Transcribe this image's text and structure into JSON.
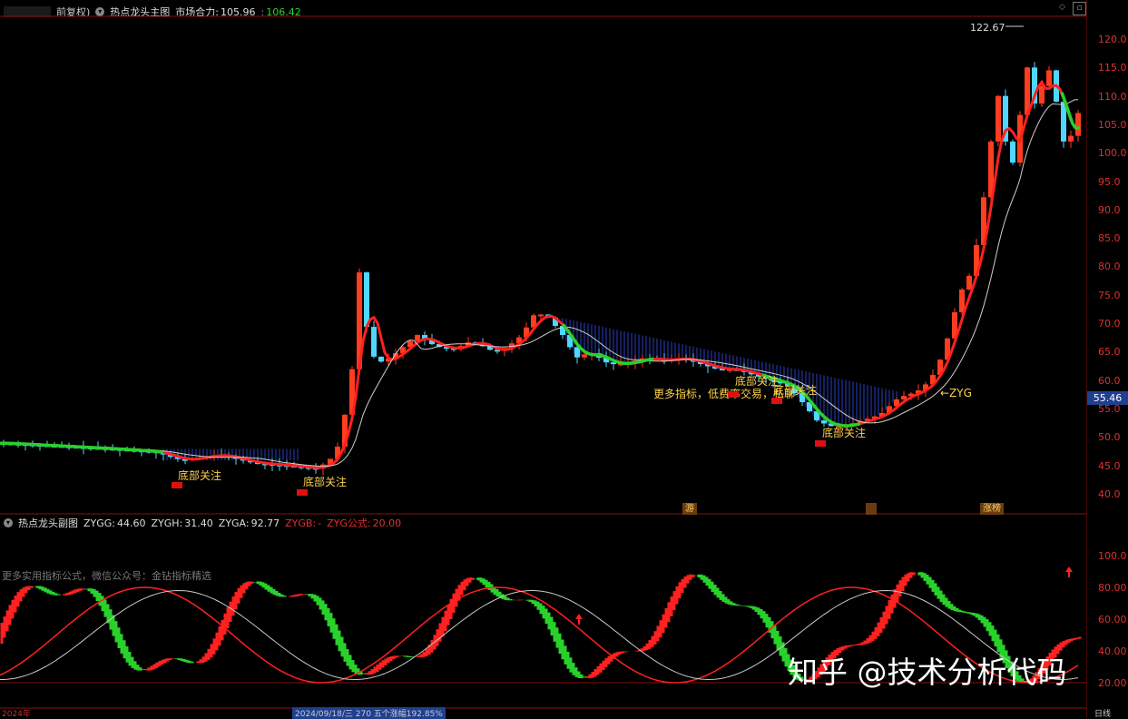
{
  "main_panel": {
    "header_prefix": "前复权)",
    "indicator_name": "热点龙头主图",
    "market_power_label": "市场合力:",
    "market_power_value": "105.96",
    "market_power_value2": "106.42",
    "peak_label": "122.67",
    "price_axis": [
      "120.0",
      "115.0",
      "110.0",
      "105.0",
      "100.0",
      "95.0",
      "90.0",
      "85.0",
      "80.0",
      "75.0",
      "70.0",
      "65.0",
      "60.0",
      "55.0",
      "50.0",
      "45.0",
      "40.0"
    ],
    "current_price": "55.46",
    "zyg_label": "←ZYG",
    "notes": [
      {
        "text": "底部关注"
      },
      {
        "text": "底部关注"
      },
      {
        "text": "更多指标，低费率交易，私聊"
      },
      {
        "text": "底部关注"
      },
      {
        "text": "底部关注"
      },
      {
        "text": "底部关注"
      }
    ],
    "bottom_tags": [
      "游",
      "",
      "涨榜"
    ]
  },
  "sub_panel": {
    "indicator_name": "热点龙头副图",
    "zygg_label": "ZYGG:",
    "zygg_value": "44.60",
    "zygh_label": "ZYGH:",
    "zygh_value": "31.40",
    "zyga_label": "ZYGA:",
    "zyga_value": "92.77",
    "zygb_label": "ZYGB:",
    "zygb_value": "-",
    "formula_label": "ZYG公式:",
    "formula_value": "20.00",
    "promo_text": "更多实用指标公式，微信公众号：金钻指标精选",
    "axis": [
      "100.0",
      "80.00",
      "60.00",
      "40.00",
      "20.00"
    ]
  },
  "bottom_bar": {
    "date_label": "2024/09/18/三  270 五个涨幅192.85%",
    "left_label": "2024年",
    "right_label": "日线"
  },
  "watermark": "知乎 @技术分析代码",
  "colors": {
    "up": "#ff3d1f",
    "down": "#4fd7ff",
    "green": "#29d12b",
    "red_line": "#ff2020",
    "grid": "#8a1010"
  }
}
